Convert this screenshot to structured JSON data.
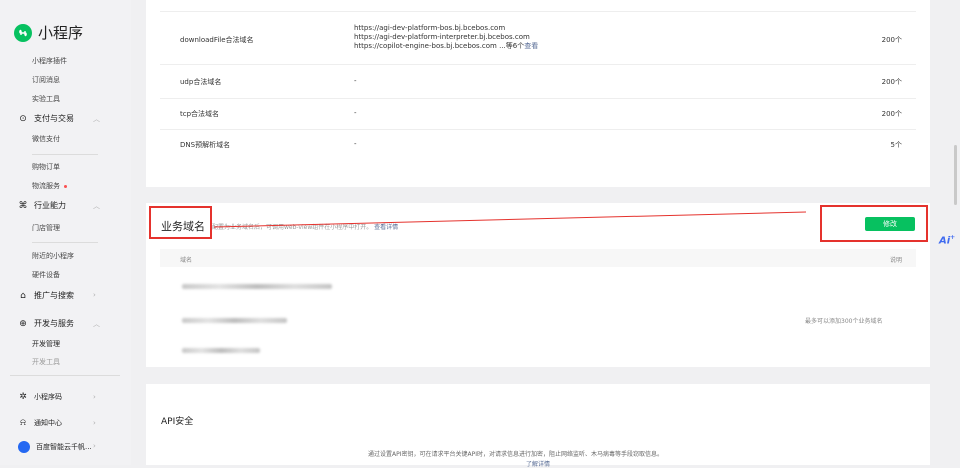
{
  "sidebar": {
    "app_title": "小程序",
    "items": [
      {
        "label": "小程序插件"
      },
      {
        "label": "订阅消息"
      },
      {
        "label": "实验工具"
      },
      {
        "label": "支付与交易"
      },
      {
        "label": "微信支付"
      },
      {
        "label": "购物订单"
      },
      {
        "label": "物流服务"
      },
      {
        "label": "行业能力"
      },
      {
        "label": "门店管理"
      },
      {
        "label": "附近的小程序"
      },
      {
        "label": "硬件设备"
      },
      {
        "label": "推广与搜索"
      },
      {
        "label": "开发与服务"
      },
      {
        "label": "开发管理"
      },
      {
        "label": "开发工具"
      },
      {
        "label": "小程序码"
      },
      {
        "label": "通知中心"
      },
      {
        "label": "百度智能云千帆..."
      }
    ]
  },
  "server_domains": {
    "rows": [
      {
        "name": "downloadFile合法域名",
        "values": [
          "https://agi-dev-platform-bos.bj.bcebos.com",
          "https://agi-dev-platform-interpreter.bj.bcebos.com",
          "https://copilot-engine-bos.bj.bcebos.com ...等6个"
        ],
        "more": "查看",
        "limit": "200个"
      },
      {
        "name": "udp合法域名",
        "value": "-",
        "limit": "200个"
      },
      {
        "name": "tcp合法域名",
        "value": "-",
        "limit": "200个"
      },
      {
        "name": "DNS预解析域名",
        "value": "-",
        "limit": "5个"
      }
    ]
  },
  "business_domain": {
    "title": "业务域名",
    "desc": "配置为业务域名后，可调用web-view组件在小程序中打开。",
    "detail_link": "查看详情",
    "modify_button": "修改",
    "col_domain": "域名",
    "col_note": "说明",
    "note_text": "最多可以添加300个业务域名"
  },
  "api_security": {
    "title": "API安全",
    "desc": "通过设置API密钥，可在请求平台关键API时，对请求信息进行加密，阻止网络监听、木马病毒等手段窃取信息。",
    "link": "了解详情"
  },
  "ai_badge": "Ai",
  "colors": {
    "accent": "#07c160",
    "annotation": "#e5322d",
    "link": "#576b95"
  }
}
